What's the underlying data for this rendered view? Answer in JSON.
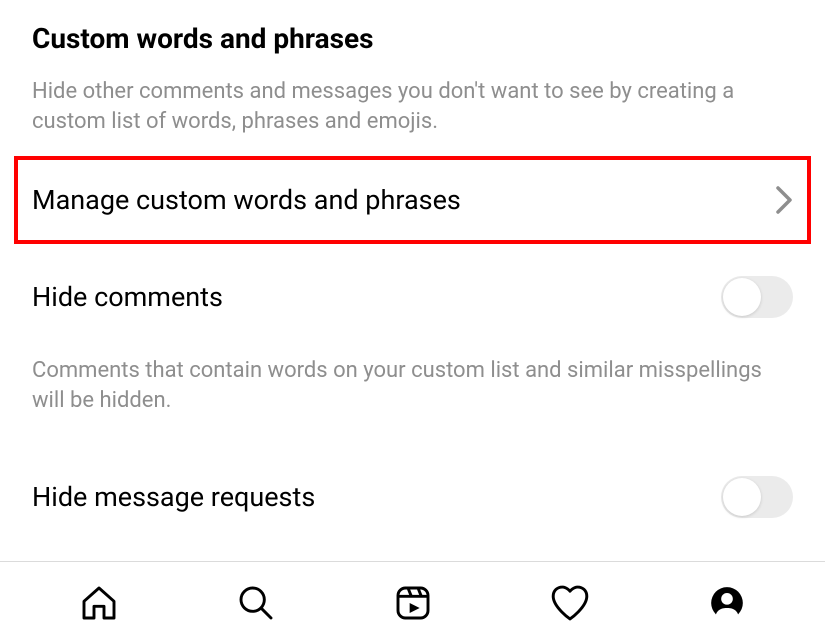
{
  "header": {
    "title": "Custom words and phrases",
    "description": "Hide other comments and messages you don't want to see by creating a custom list of words, phrases and emojis."
  },
  "manage_row": {
    "label": "Manage custom words and phrases"
  },
  "hide_comments": {
    "label": "Hide comments",
    "toggle_on": false,
    "description": "Comments that contain words on your custom list and similar misspellings will be hidden."
  },
  "hide_requests": {
    "label": "Hide message requests",
    "toggle_on": false
  },
  "nav": {
    "items": [
      {
        "name": "home-icon"
      },
      {
        "name": "search-icon"
      },
      {
        "name": "reels-icon"
      },
      {
        "name": "activity-icon"
      },
      {
        "name": "profile-icon"
      }
    ]
  }
}
